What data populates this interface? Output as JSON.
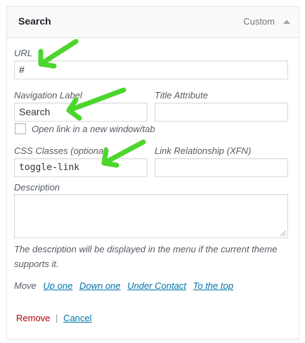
{
  "header": {
    "title": "Search",
    "item_type": "Custom",
    "toggle_icon": "triangle-up-icon"
  },
  "fields": {
    "url": {
      "label": "URL",
      "value": "#"
    },
    "navigation_label": {
      "label": "Navigation Label",
      "value": "Search"
    },
    "title_attribute": {
      "label": "Title Attribute",
      "value": ""
    },
    "open_new_tab": {
      "label": "Open link in a new window/tab",
      "checked": false
    },
    "css_classes": {
      "label": "CSS Classes (optional)",
      "value": "toggle-link"
    },
    "link_relationship": {
      "label": "Link Relationship (XFN)",
      "value": ""
    },
    "description": {
      "label": "Description",
      "value": "",
      "help": "The description will be displayed in the menu if the current theme supports it."
    }
  },
  "move": {
    "label": "Move",
    "links": [
      "Up one",
      "Down one",
      "Under Contact",
      "To the top"
    ]
  },
  "actions": {
    "remove": "Remove",
    "separator": "|",
    "cancel": "Cancel"
  },
  "annotations": {
    "arrow_color": "#4cd62b"
  }
}
